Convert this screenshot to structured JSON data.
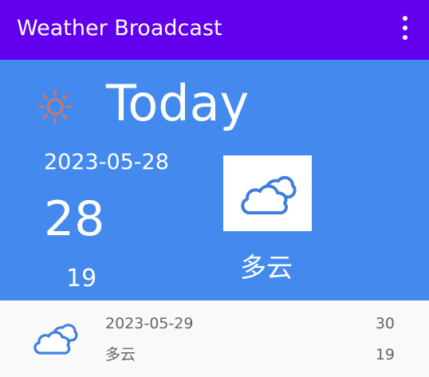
{
  "app_bar": {
    "title": "Weather Broadcast",
    "menu_icon": "more-vert-icon",
    "background": "#6200ee"
  },
  "today": {
    "label": "Today",
    "status_icon": "sun-icon",
    "date": "2023-05-28",
    "high": "28",
    "low": "19",
    "condition": "多云",
    "condition_icon": "cloud-icon",
    "background": "#448aee"
  },
  "forecast": [
    {
      "date": "2023-05-29",
      "condition": "多云",
      "condition_icon": "cloud-icon",
      "high": "30",
      "low": "19"
    }
  ],
  "colors": {
    "sun": "#e8734a",
    "cloud": "#3f7fe0"
  }
}
